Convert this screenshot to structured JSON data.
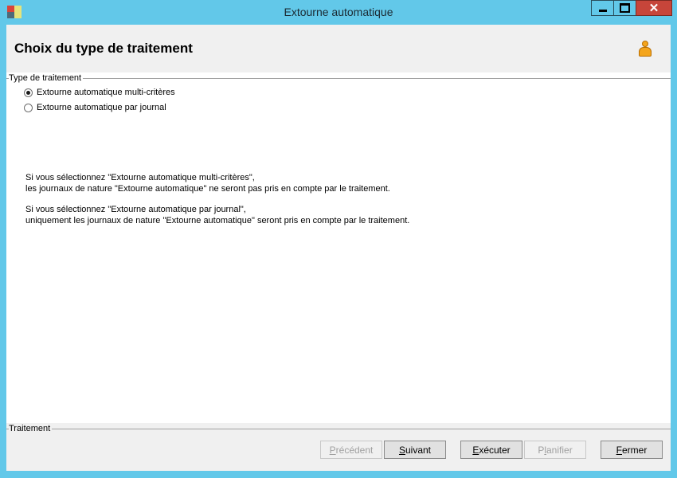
{
  "window": {
    "title": "Extourne automatique"
  },
  "header": {
    "title": "Choix du type de traitement"
  },
  "type_group": {
    "label": "Type de traitement",
    "options": [
      {
        "label": "Extourne automatique multi-critères",
        "checked": true
      },
      {
        "label": "Extourne automatique par journal",
        "checked": false
      }
    ]
  },
  "info": {
    "para1_line1": "Si vous sélectionnez \"Extourne automatique multi-critères\",",
    "para1_line2": "les journaux de nature \"Extourne automatique\" ne seront pas pris en compte par le traitement.",
    "para2_line1": "Si vous sélectionnez \"Extourne automatique par journal\",",
    "para2_line2": "uniquement les journaux de nature \"Extourne automatique\" seront pris en compte par le traitement."
  },
  "footer": {
    "group_label": "Traitement",
    "buttons": {
      "precedent": {
        "mnemonic": "P",
        "rest": "récédent",
        "enabled": false
      },
      "suivant": {
        "mnemonic": "S",
        "rest": "uivant",
        "enabled": true
      },
      "executer": {
        "mnemonic": "E",
        "rest": "xécuter",
        "enabled": true
      },
      "planifier": {
        "pre": "P",
        "mnemonic": "l",
        "rest": "anifier",
        "enabled": false
      },
      "fermer": {
        "mnemonic": "F",
        "rest": "ermer",
        "enabled": true
      }
    }
  },
  "icons": {
    "app": "app-icon",
    "user": "person-icon",
    "minimize": "minimize-icon",
    "maximize": "maximize-icon",
    "close": "close-icon"
  },
  "colors": {
    "frame": "#62c8e9",
    "close": "#c7453a",
    "header_bg": "#f0f0f0",
    "client_bg": "#ffffff"
  }
}
